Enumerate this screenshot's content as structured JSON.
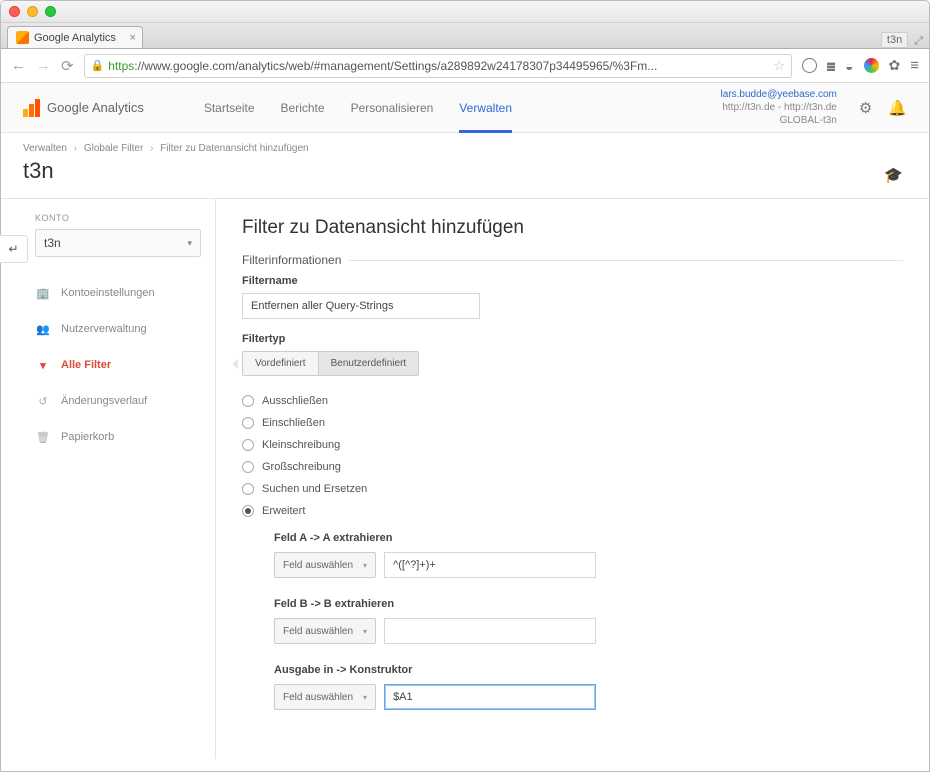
{
  "browser": {
    "tab_title": "Google Analytics",
    "right_badge": "t3n",
    "url_scheme": "https",
    "url_host": "://www.google.com",
    "url_path": "/analytics/web/#management/Settings/a289892w24178307p34495965/%3Fm..."
  },
  "ga": {
    "brand": "Google Analytics",
    "tabs": {
      "start": "Startseite",
      "reports": "Berichte",
      "personalize": "Personalisieren",
      "admin": "Verwalten"
    },
    "user_email": "lars.budde@yeebase.com",
    "property_line": "http://t3n.de - http://t3n.de",
    "global_line": "GLOBAL-t3n"
  },
  "crumbs": {
    "c1": "Verwalten",
    "c2": "Globale Filter",
    "c3": "Filter zu Datenansicht hinzufügen"
  },
  "page_title": "t3n",
  "sidebar": {
    "konto_label": "KONTO",
    "account": "t3n",
    "items": [
      "Kontoeinstellungen",
      "Nutzerverwaltung",
      "Alle Filter",
      "Änderungsverlauf",
      "Papierkorb"
    ]
  },
  "form": {
    "heading": "Filter zu Datenansicht hinzufügen",
    "filterinfo": "Filterinformationen",
    "filtername_label": "Filtername",
    "filtername_value": "Entfernen aller Query-Strings",
    "filtertype_label": "Filtertyp",
    "type_tabs": {
      "predef": "Vordefiniert",
      "custom": "Benutzerdefiniert"
    },
    "radios": [
      "Ausschließen",
      "Einschließen",
      "Kleinschreibung",
      "Großschreibung",
      "Suchen und Ersetzen",
      "Erweitert"
    ],
    "field_a_label": "Feld A -> A extrahieren",
    "field_b_label": "Feld B -> B extrahieren",
    "field_out_label": "Ausgabe in -> Konstruktor",
    "field_select": "Feld auswählen",
    "field_a_value": "^([^?]+)+",
    "field_b_value": "",
    "field_out_value": "$A1"
  }
}
